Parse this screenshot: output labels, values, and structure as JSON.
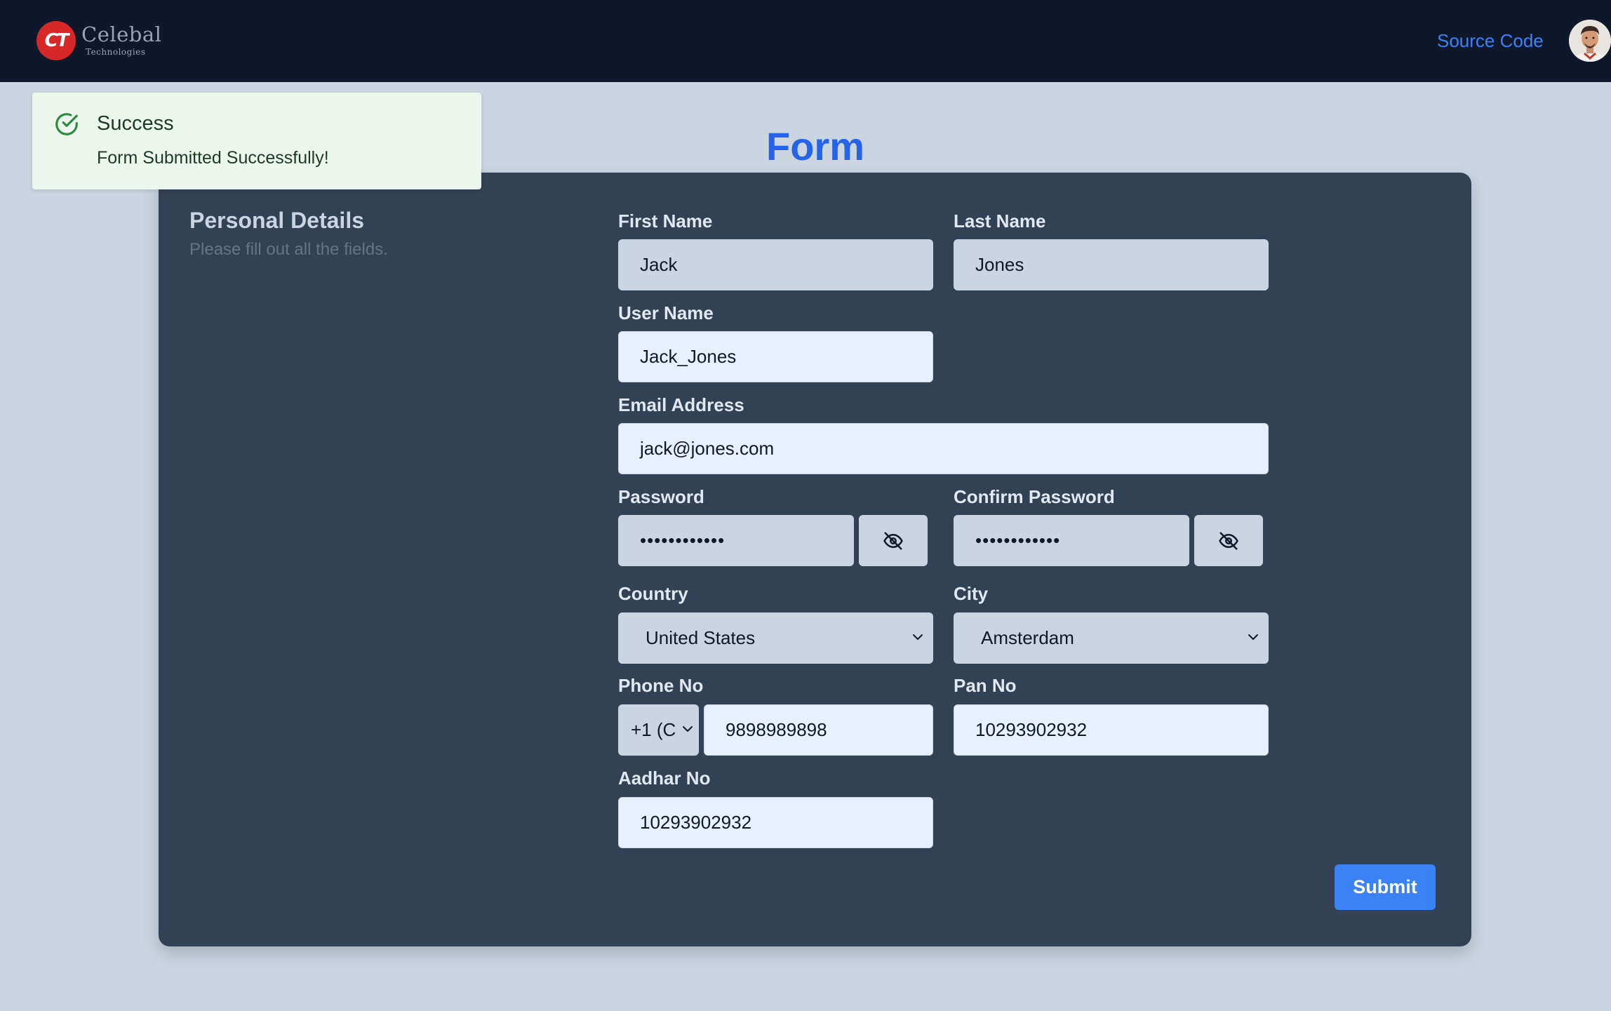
{
  "header": {
    "logo_mark": "CT",
    "logo_name": "Celebal",
    "logo_sub": "Technologies",
    "source_link": "Source Code"
  },
  "toast": {
    "title": "Success",
    "message": "Form Submitted Successfully!"
  },
  "page_title": "Form",
  "section": {
    "title": "Personal Details",
    "subtitle": "Please fill out all the fields."
  },
  "fields": {
    "first_name": {
      "label": "First Name",
      "value": "Jack"
    },
    "last_name": {
      "label": "Last Name",
      "value": "Jones"
    },
    "user_name": {
      "label": "User Name",
      "value": "Jack_Jones"
    },
    "email": {
      "label": "Email Address",
      "value": "jack@jones.com"
    },
    "password": {
      "label": "Password",
      "value": "••••••••••••"
    },
    "confirm_password": {
      "label": "Confirm Password",
      "value": "••••••••••••"
    },
    "country": {
      "label": "Country",
      "value": "United States"
    },
    "city": {
      "label": "City",
      "value": "Amsterdam"
    },
    "phone": {
      "label": "Phone No",
      "code": "+1 (C",
      "value": "9898989898"
    },
    "pan": {
      "label": "Pan No",
      "value": "10293902932"
    },
    "aadhar": {
      "label": "Aadhar No",
      "value": "10293902932"
    }
  },
  "submit_label": "Submit",
  "colors": {
    "topbar": "#0f172a",
    "background": "#cbd5e1",
    "card": "#334155",
    "accent": "#3b82f6",
    "title": "#2563eb",
    "toast_bg": "#ecf6ec",
    "success_icon": "#2e8b3e"
  },
  "icons": {
    "toast": "check-circle-icon",
    "password_toggle": "eye-off-icon",
    "select": "chevron-down-icon"
  }
}
